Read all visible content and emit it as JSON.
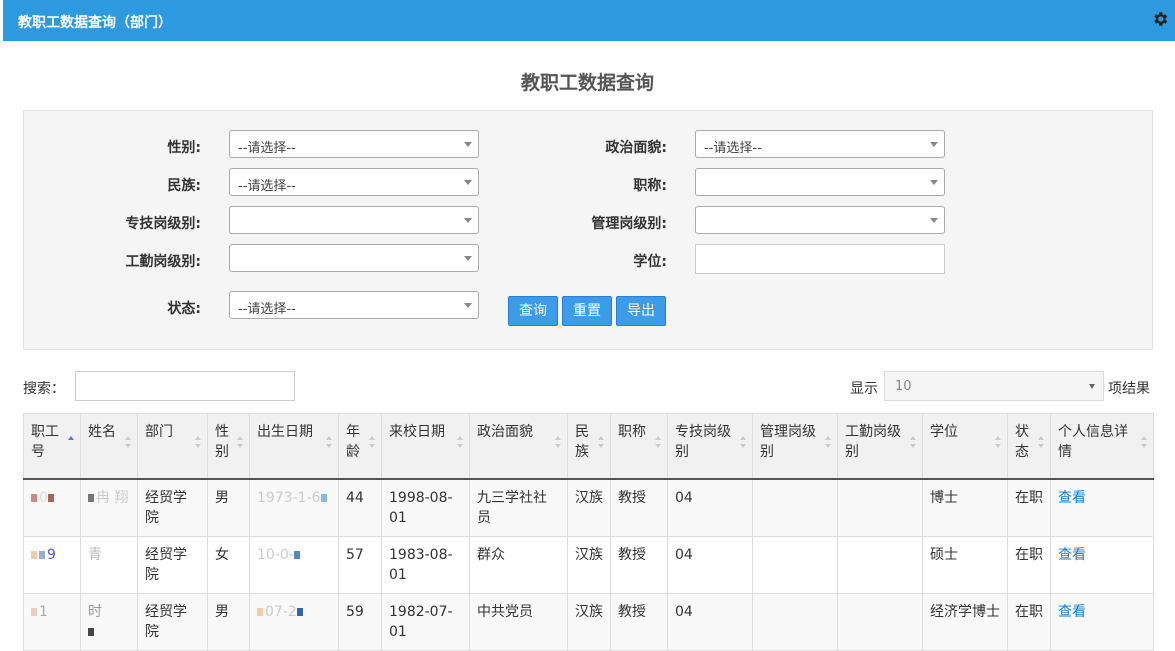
{
  "header": {
    "title": "教职工数据查询（部门）",
    "settings_icon": "gear-icon"
  },
  "page_title": "教职工数据查询",
  "form": {
    "gender_label": "性别:",
    "gender_value": "--请选择--",
    "politics_label": "政治面貌:",
    "politics_value": "--请选择--",
    "ethnicity_label": "民族:",
    "ethnicity_value": "--请选择--",
    "title_label": "职称:",
    "title_value": "",
    "tech_level_label": "专技岗级别:",
    "tech_level_value": "",
    "mgmt_level_label": "管理岗级别:",
    "mgmt_level_value": "",
    "worker_level_label": "工勤岗级别:",
    "worker_level_value": "",
    "degree_label": "学位:",
    "degree_value": "",
    "status_label": "状态:",
    "status_value": "--请选择--",
    "query_button": "查询",
    "reset_button": "重置",
    "export_button": "导出"
  },
  "table_controls": {
    "search_label": "搜索：",
    "search_value": "",
    "show_label": "显示",
    "page_size": "10",
    "result_label": "项结果"
  },
  "table": {
    "columns": [
      "职工号",
      "姓名",
      "部门",
      "性别",
      "出生日期",
      "年龄",
      "来校日期",
      "政治面貌",
      "民族",
      "职称",
      "专技岗级别",
      "管理岗级别",
      "工勤岗级别",
      "学位",
      "状态",
      "个人信息详情"
    ],
    "rows": [
      {
        "id": "0",
        "name": "冉\n翔",
        "dept": "经贸学院",
        "gender": "男",
        "birth": "1973-1-6",
        "age": "44",
        "join": "1998-08-01",
        "politics": "九三学社社员",
        "ethnicity": "汉族",
        "title": "教授",
        "tech": "04",
        "mgmt": "",
        "worker": "",
        "degree": "博士",
        "status": "在职",
        "detail": "查看"
      },
      {
        "id": "9",
        "name": "青",
        "dept": "经贸学院",
        "gender": "女",
        "birth": "10-0-",
        "age": "57",
        "join": "1983-08-01",
        "politics": "群众",
        "ethnicity": "汉族",
        "title": "教授",
        "tech": "04",
        "mgmt": "",
        "worker": "",
        "degree": "硕士",
        "status": "在职",
        "detail": "查看"
      },
      {
        "id": "1",
        "name": "时",
        "dept": "经贸学院",
        "gender": "男",
        "birth": "07-2",
        "age": "59",
        "join": "1982-07-01",
        "politics": "中共党员",
        "ethnicity": "汉族",
        "title": "教授",
        "tech": "04",
        "mgmt": "",
        "worker": "",
        "degree": "经济学博士",
        "status": "在职",
        "detail": "查看"
      }
    ]
  }
}
